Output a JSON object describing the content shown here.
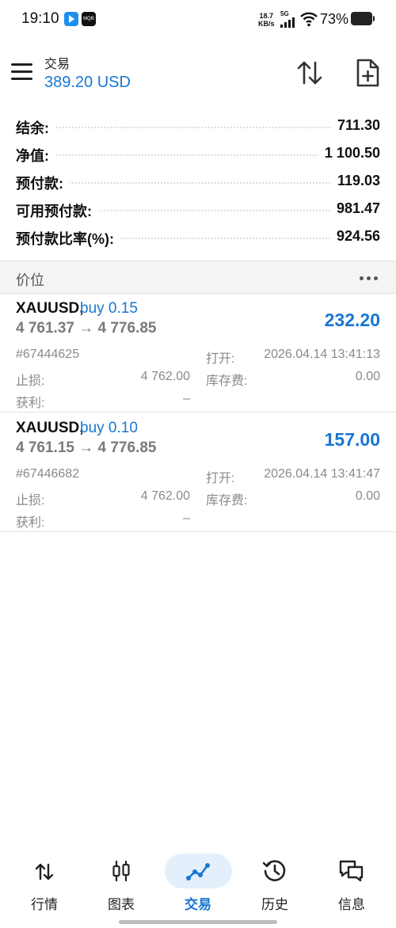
{
  "status_bar": {
    "time": "19:10",
    "net_speed_value": "18.7",
    "net_speed_unit": "KB/s",
    "network_type": "5G",
    "battery": "73%",
    "app_icon_label": "MQB"
  },
  "header": {
    "title": "交易",
    "balance": "389.20 USD"
  },
  "summary": [
    {
      "label": "结余:",
      "value": "711.30"
    },
    {
      "label": "净值:",
      "value": "1 100.50"
    },
    {
      "label": "预付款:",
      "value": "119.03"
    },
    {
      "label": "可用预付款:",
      "value": "981.47"
    },
    {
      "label": "预付款比率(%):",
      "value": "924.56"
    }
  ],
  "section": {
    "title": "价位"
  },
  "positions": [
    {
      "symbol": "XAUUSD,",
      "side": "buy 0.15",
      "prices": "4 761.37 → 4 776.85",
      "profit": "232.20",
      "ticket": "#67444625",
      "open_label": "打开:",
      "open_time": "2026.04.14 13:41:13",
      "sl_label": "止损:",
      "sl_value": "4 762.00",
      "swap_label": "库存费:",
      "swap_value": "0.00",
      "tp_label": "获利:",
      "tp_value": "–"
    },
    {
      "symbol": "XAUUSD,",
      "side": "buy 0.10",
      "prices": "4 761.15 → 4 776.85",
      "profit": "157.00",
      "ticket": "#67446682",
      "open_label": "打开:",
      "open_time": "2026.04.14 13:41:47",
      "sl_label": "止损:",
      "sl_value": "4 762.00",
      "swap_label": "库存费:",
      "swap_value": "0.00",
      "tp_label": "获利:",
      "tp_value": "–"
    }
  ],
  "bottom_nav": [
    {
      "label": "行情",
      "icon": "quotes-arrows-icon"
    },
    {
      "label": "图表",
      "icon": "candlestick-chart-icon"
    },
    {
      "label": "交易",
      "icon": "trade-line-icon",
      "active": true
    },
    {
      "label": "历史",
      "icon": "history-clock-icon"
    },
    {
      "label": "信息",
      "icon": "messages-chat-icon"
    }
  ],
  "colors": {
    "accent": "#1976d2",
    "active_nav_bg": "#e3f0fc",
    "muted_text": "#8a8a8a"
  }
}
